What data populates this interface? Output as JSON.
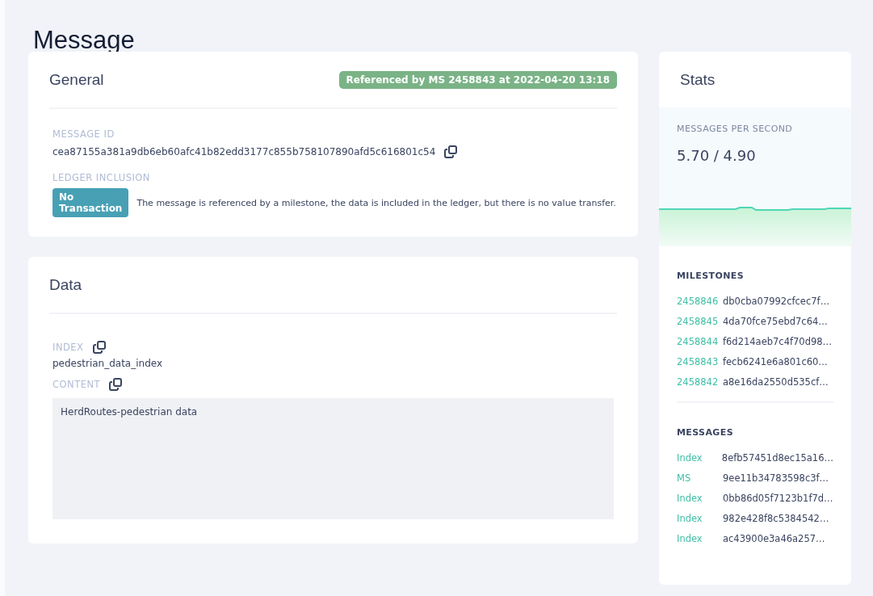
{
  "page": {
    "title": "Message"
  },
  "general": {
    "title": "General",
    "status_badge": "Referenced by MS 2458843 at 2022-04-20 13:18",
    "message_id_label": "MESSAGE ID",
    "message_id": "cea87155a381a9db6eb60afc41b82edd3177c855b758107890afd5c616801c54",
    "ledger_label": "LEDGER INCLUSION",
    "ledger_badge": "No Transaction",
    "ledger_text": "The message is referenced by a milestone, the data is included in the ledger, but there is no value transfer."
  },
  "data": {
    "title": "Data",
    "index_label": "INDEX",
    "index": "pedestrian_data_index",
    "content_label": "CONTENT",
    "content": "HerdRoutes-pedestrian data"
  },
  "stats": {
    "title": "Stats",
    "mps_label": "MESSAGES PER SECOND",
    "mps_value": "5.70 / 4.90",
    "milestones_label": "MILESTONES",
    "milestones": [
      {
        "index": "2458846",
        "id": "db0cba07992cfcec7f…"
      },
      {
        "index": "2458845",
        "id": "4da70fce75ebd7c64…"
      },
      {
        "index": "2458844",
        "id": "f6d214aeb7c4f70d98…"
      },
      {
        "index": "2458843",
        "id": "fecb6241e6a801c60…"
      },
      {
        "index": "2458842",
        "id": "a8e16da2550d535cf…"
      }
    ],
    "messages_label": "MESSAGES",
    "messages": [
      {
        "type": "Index",
        "id": "8efb57451d8ec15a16…"
      },
      {
        "type": "MS",
        "id": "9ee11b34783598c3f…"
      },
      {
        "type": "Index",
        "id": "0bb86d05f7123b1f7d…"
      },
      {
        "type": "Index",
        "id": "982e428f8c5384542…"
      },
      {
        "type": "Index",
        "id": "ac43900e3a46a257…"
      }
    ]
  }
}
